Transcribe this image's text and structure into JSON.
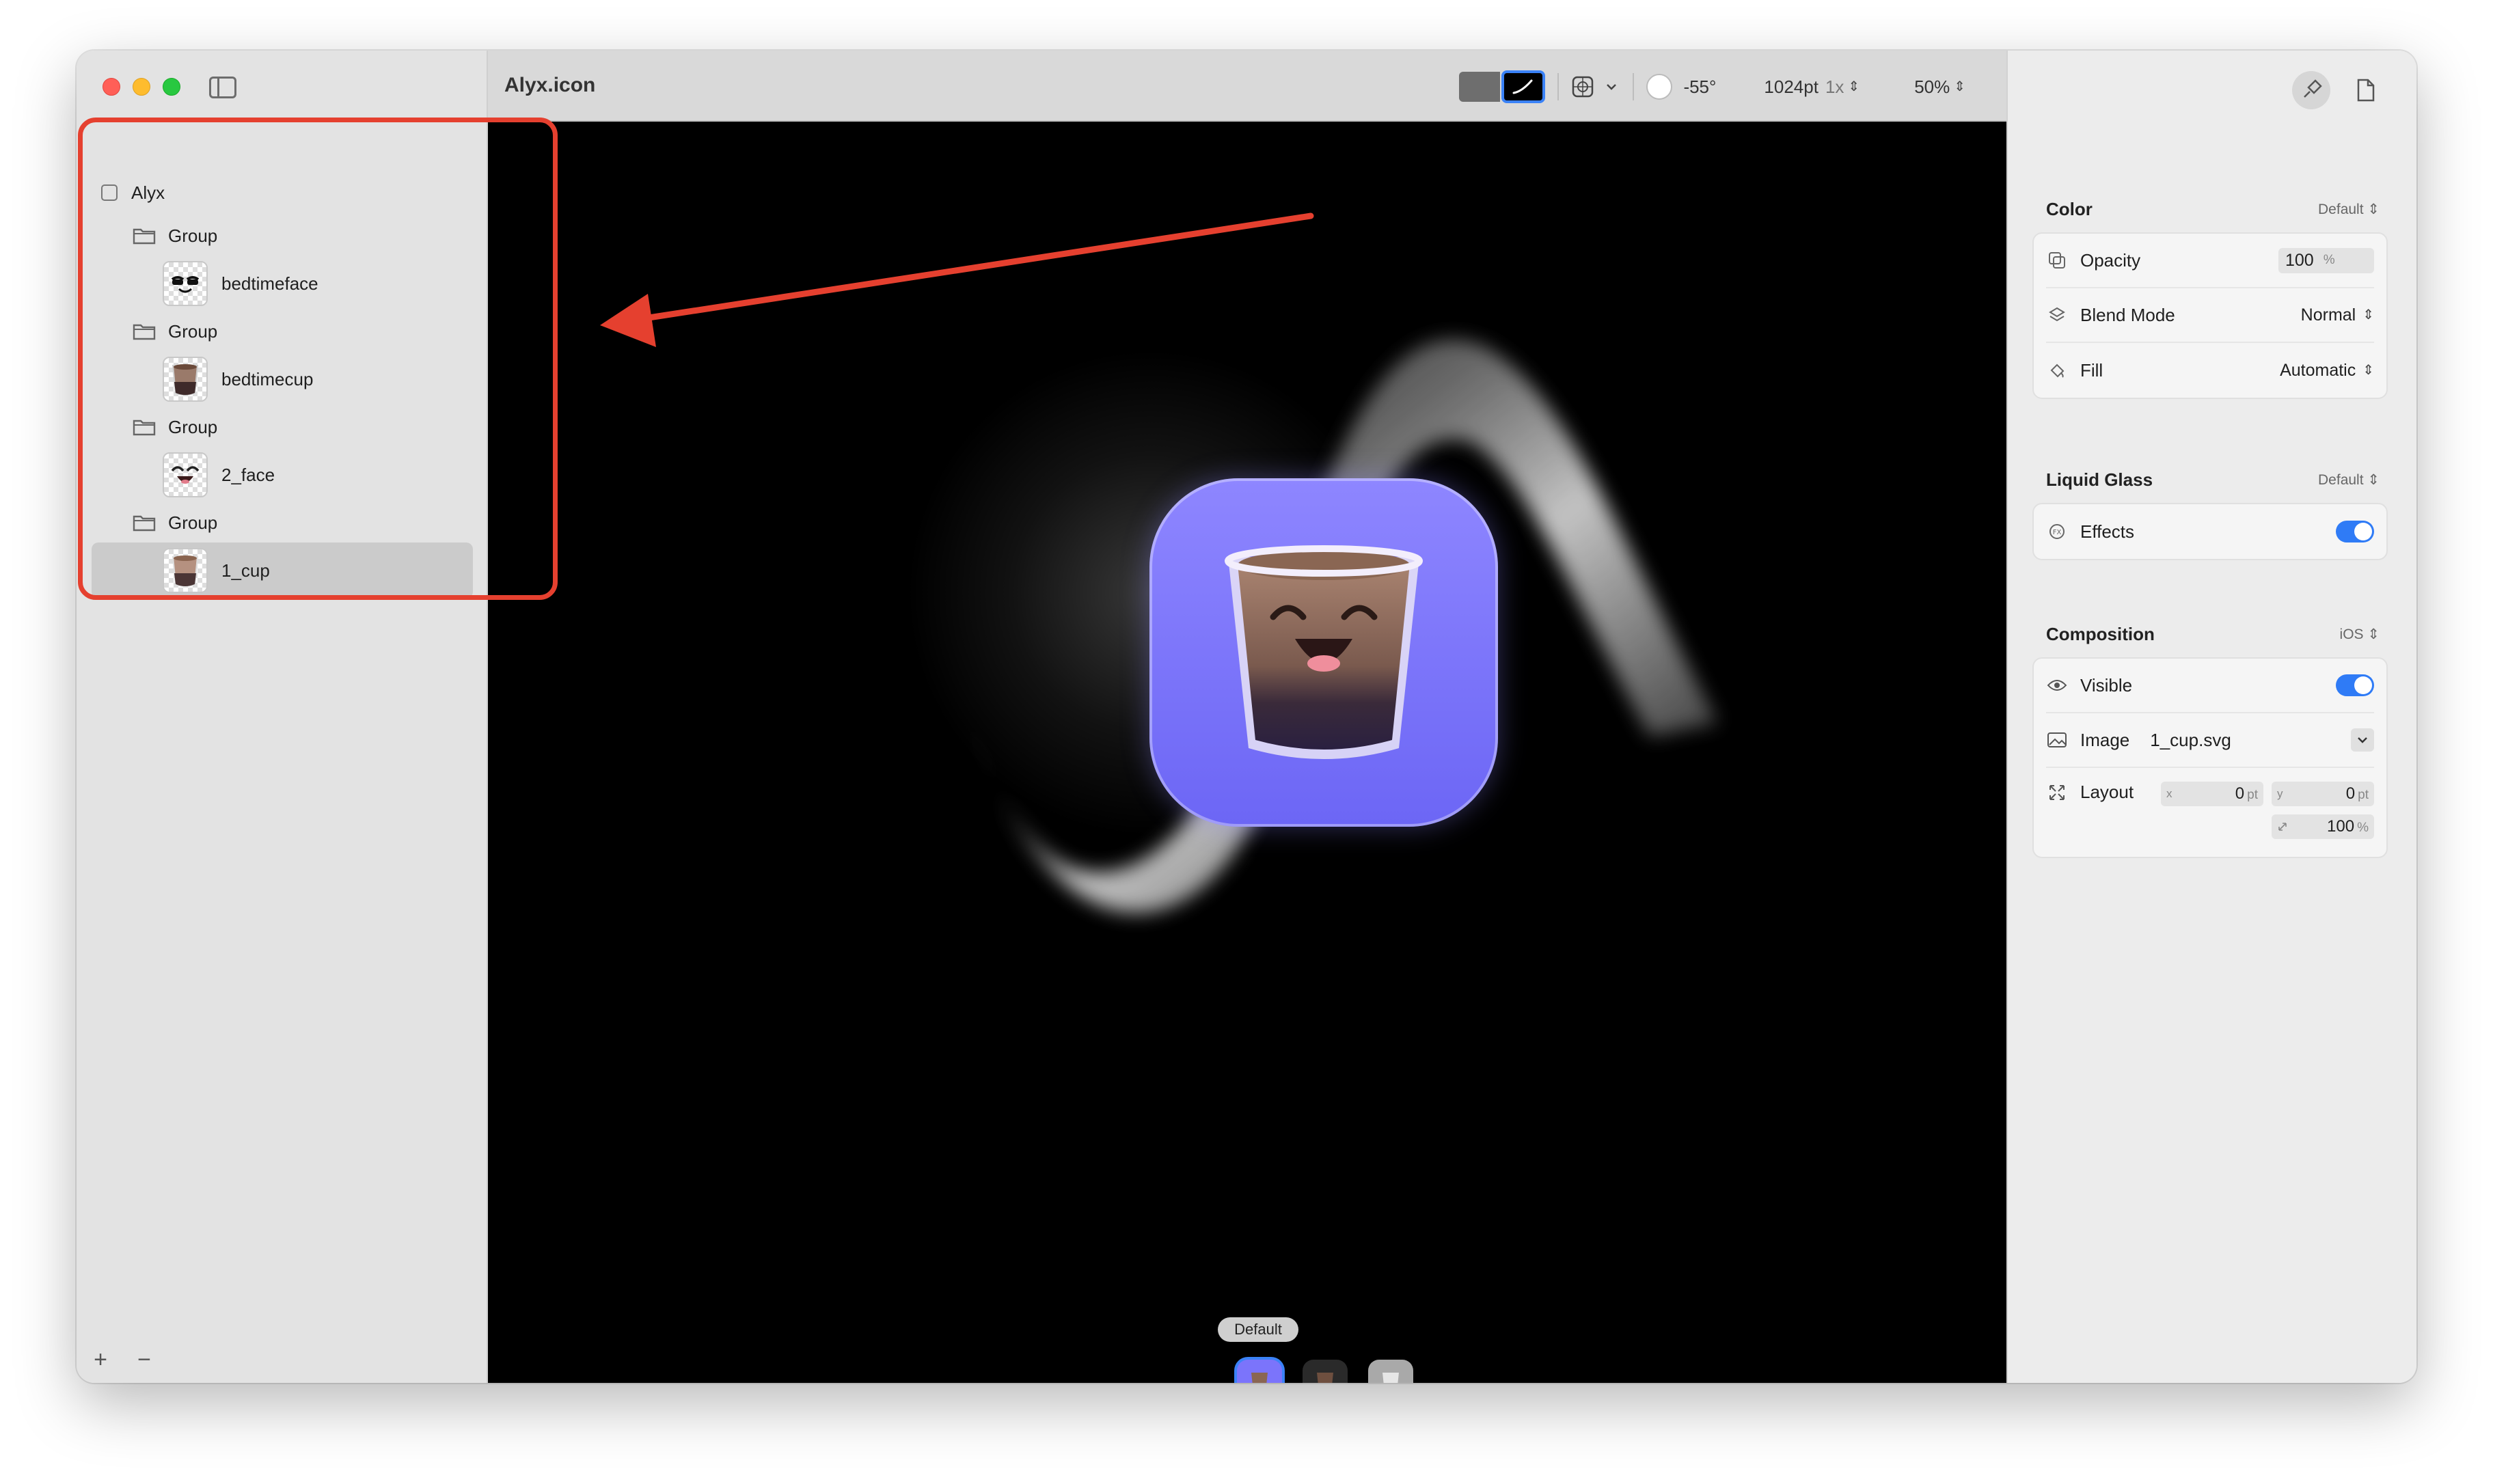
{
  "window": {
    "document_title": "Alyx.icon"
  },
  "sidebar": {
    "root": {
      "label": "Alyx"
    },
    "groups": [
      {
        "label": "Group",
        "item": {
          "label": "bedtimeface"
        }
      },
      {
        "label": "Group",
        "item": {
          "label": "bedtimecup"
        }
      },
      {
        "label": "Group",
        "item": {
          "label": "2_face"
        }
      },
      {
        "label": "Group",
        "item": {
          "label": "1_cup"
        }
      }
    ],
    "footer": {
      "add_label": "+",
      "remove_label": "−"
    }
  },
  "toolbar": {
    "light_angle": "-55°",
    "size_label": "1024pt",
    "scale_label": "1x",
    "zoom_label": "50%"
  },
  "canvas": {
    "appearance_label": "Default",
    "appearances": [
      "default",
      "dark",
      "tinted"
    ],
    "icon_background": "#7b74fb"
  },
  "inspector": {
    "color": {
      "title": "Color",
      "option": "Default",
      "opacity_label": "Opacity",
      "opacity_value": "100",
      "opacity_unit": "%",
      "blend_label": "Blend Mode",
      "blend_value": "Normal",
      "fill_label": "Fill",
      "fill_value": "Automatic"
    },
    "liquid_glass": {
      "title": "Liquid Glass",
      "option": "Default",
      "effects_label": "Effects",
      "effects_on": true
    },
    "composition": {
      "title": "Composition",
      "option": "iOS",
      "visible_label": "Visible",
      "visible_on": true,
      "image_label": "Image",
      "image_value": "1_cup.svg",
      "layout_label": "Layout",
      "x_key": "x",
      "x_value": "0",
      "y_key": "y",
      "y_value": "0",
      "unit_pt": "pt",
      "scale_value": "100",
      "scale_unit": "%"
    }
  },
  "colors": {
    "accent": "#3a82f7",
    "annotation": "#e5402f",
    "icon_purple": "#7b74fb"
  }
}
